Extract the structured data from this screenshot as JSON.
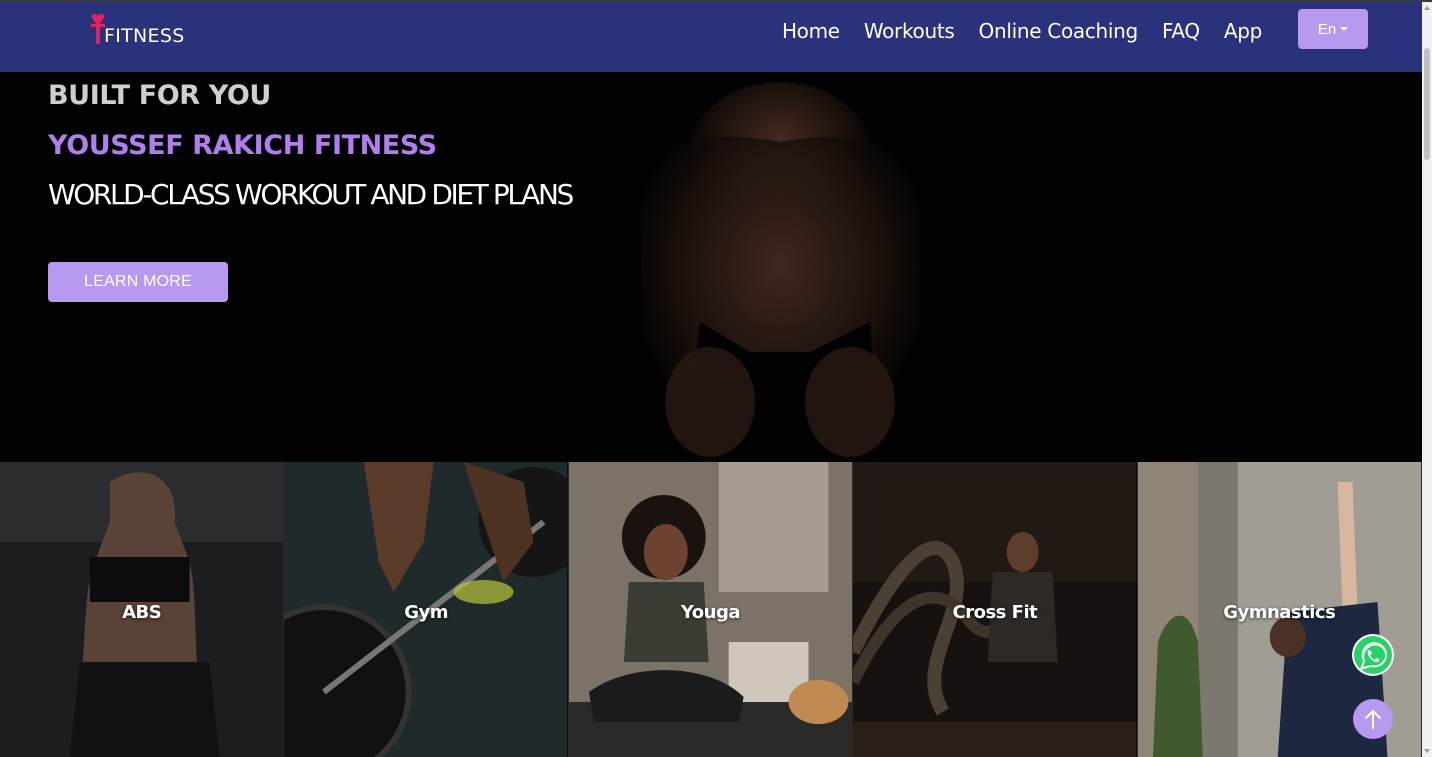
{
  "navbar": {
    "logo_text": "FITNESS",
    "links": [
      {
        "label": "Home"
      },
      {
        "label": "Workouts"
      },
      {
        "label": "Online Coaching"
      },
      {
        "label": "FAQ"
      },
      {
        "label": "App"
      }
    ],
    "language_label": "En"
  },
  "hero": {
    "tagline": "BUILT FOR YOU",
    "brand": "YOUSSEF RAKICH FITNESS",
    "headline": "WORLD-CLASS WORKOUT AND DIET PLANS",
    "cta_label": "LEARN MORE"
  },
  "categories": [
    {
      "label": "ABS"
    },
    {
      "label": "Gym"
    },
    {
      "label": "Youga"
    },
    {
      "label": "Cross Fit"
    },
    {
      "label": "Gymnastics"
    }
  ],
  "colors": {
    "navbar": "#29327a",
    "accent": "#b79af0",
    "brand_text": "#b17ef0",
    "whatsapp": "#25d366"
  },
  "icons": {
    "logo": "dumbbell-heart-icon",
    "whatsapp": "whatsapp-icon",
    "scroll_top": "arrow-up-icon",
    "language": "chevron-down-icon"
  }
}
